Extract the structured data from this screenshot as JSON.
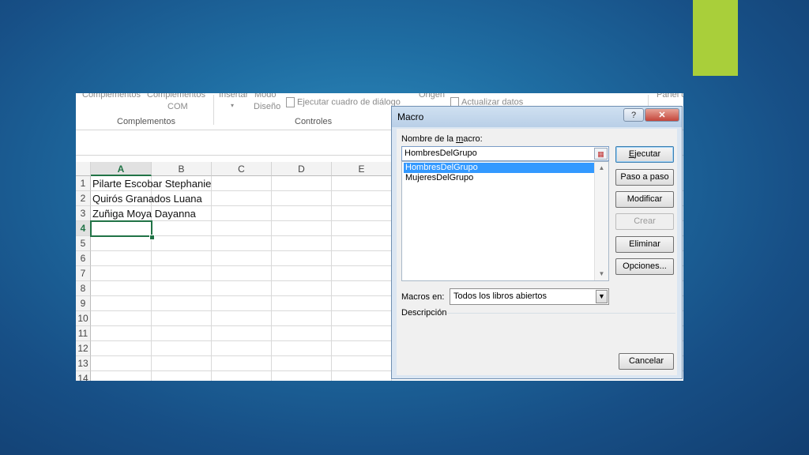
{
  "slide": {
    "accent_color": "#a9cf3a"
  },
  "ribbon": {
    "complementos1": "Complementos",
    "complementos2_line1": "Complementos",
    "complementos2_line2": "COM",
    "insertar": "Insertar",
    "modo": "Modo",
    "diseno": "Diseño",
    "ejecutar_cuadro": "Ejecutar cuadro de diálogo",
    "origen": "Origen",
    "actualizar": "Actualizar datos",
    "panel": "Panel d",
    "group_complementos": "Complementos",
    "group_controles": "Controles"
  },
  "sheet": {
    "columns": [
      "A",
      "B",
      "C",
      "D",
      "E"
    ],
    "selected_column": "A",
    "rows": [
      "1",
      "2",
      "3",
      "4",
      "5",
      "6",
      "7",
      "8",
      "9",
      "10",
      "11",
      "12",
      "13",
      "14"
    ],
    "selected_row": "4",
    "cells": {
      "A1": "Pilarte Escobar Stephanie",
      "A2": "Quirós Granados Luana",
      "A3": "Zuñiga Moya Dayanna"
    }
  },
  "dialog": {
    "title": "Macro",
    "help_glyph": "?",
    "close_glyph": "✕",
    "name_label_pre": "Nombre de la ",
    "name_label_u": "m",
    "name_label_post": "acro:",
    "name_value": "HombresDelGrupo",
    "macros": [
      "HombresDelGrupo",
      "MujeresDelGrupo"
    ],
    "selected_macro": "HombresDelGrupo",
    "buttons": {
      "ejecutar": "Ejecutar",
      "paso": "Paso a paso",
      "modificar": "Modificar",
      "crear": "Crear",
      "eliminar": "Eliminar",
      "opciones": "Opciones...",
      "cancelar": "Cancelar"
    },
    "macros_en_label": "Macros en:",
    "macros_en_value": "Todos los libros abiertos",
    "descripcion_label": "Descripción"
  }
}
